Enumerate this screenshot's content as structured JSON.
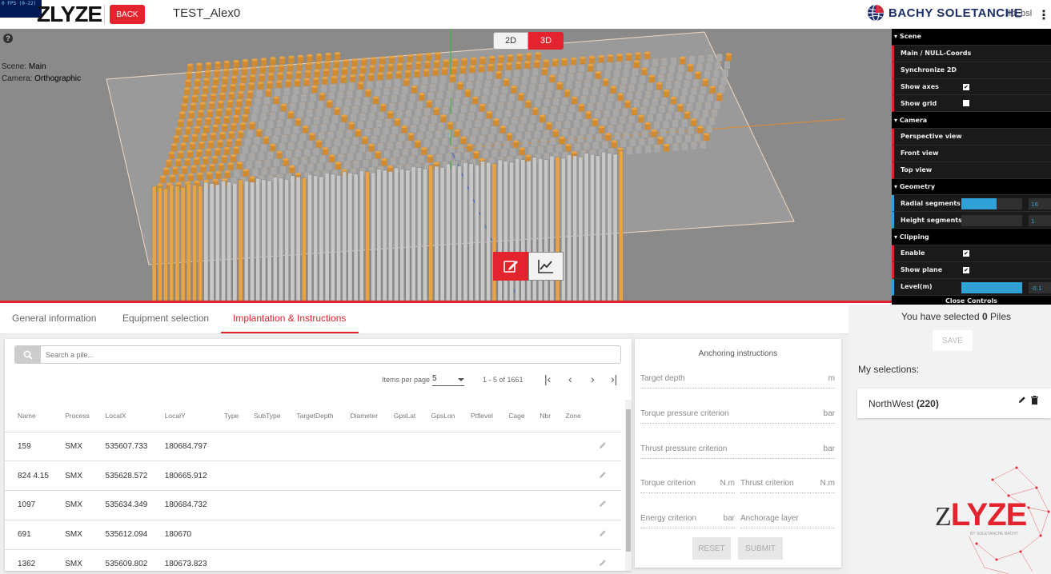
{
  "topbar": {
    "fps_text": "0 FPS (0-22)",
    "logo": "ZLYZE",
    "back_label": "BACK",
    "project_name": "TEST_Alex0",
    "brand_name": "BACHY SOLETANCHE",
    "user_name": "lld_bsl",
    "menu_glyph": "⋮"
  },
  "viewport": {
    "help_glyph": "?",
    "scene_label": "Scene:",
    "scene_value": "Main",
    "camera_label": "Camera:",
    "camera_value": "Orthographic",
    "mode_2d": "2D",
    "mode_3d": "3D",
    "active_mode": "3D"
  },
  "controls": {
    "scene_folder": "Scene",
    "main_null_coords": "Main / NULL-Coords",
    "synchronize_2d": "Synchronize 2D",
    "show_axes": "Show axes",
    "show_axes_checked": true,
    "show_grid": "Show grid",
    "show_grid_checked": false,
    "camera_folder": "Camera",
    "perspective_view": "Perspective view",
    "front_view": "Front view",
    "top_view": "Top view",
    "geometry_folder": "Geometry",
    "radial_segments": "Radial segments",
    "radial_segments_value": "16",
    "radial_segments_fill": 0.58,
    "height_segments": "Height segments",
    "height_segments_value": "1",
    "height_segments_fill": 0,
    "clipping_folder": "Clipping",
    "enable": "Enable",
    "enable_checked": true,
    "show_plane": "Show plane",
    "show_plane_checked": true,
    "level": "Level(m)",
    "level_value": "-0.1",
    "level_fill": 1,
    "close_controls": "Close Controls"
  },
  "tabs": [
    {
      "label": "General information"
    },
    {
      "label": "Equipment selection"
    },
    {
      "label": "Implantation & Instructions"
    }
  ],
  "table_card": {
    "search_placeholder": "Search a pile...",
    "items_per_page_label": "Items per page",
    "items_per_page_value": "5",
    "range_text": "1 - 5 of 1661",
    "columns": [
      "Name",
      "Process",
      "LocalX",
      "LocalY",
      "Type",
      "SubType",
      "TargetDepth",
      "Diameter",
      "GpsLat",
      "GpsLon",
      "Ptflevel",
      "Cage",
      "Nbr",
      "Zone"
    ],
    "rows": [
      {
        "name": "159",
        "process": "SMX",
        "localx": "535607.733",
        "localy": "180684.797"
      },
      {
        "name": "824 4.15",
        "process": "SMX",
        "localx": "535628.572",
        "localy": "180665.912"
      },
      {
        "name": "1097",
        "process": "SMX",
        "localx": "535634.349",
        "localy": "180684.732"
      },
      {
        "name": "691",
        "process": "SMX",
        "localx": "535612.094",
        "localy": "180670"
      },
      {
        "name": "1362",
        "process": "SMX",
        "localx": "535609.802",
        "localy": "180673.823"
      }
    ]
  },
  "anchoring": {
    "title": "Anchoring instructions",
    "target_depth": "Target depth",
    "target_depth_unit": "m",
    "torque_pressure": "Torque pressure criterion",
    "torque_pressure_unit": "bar",
    "thrust_pressure": "Thrust pressure criterion",
    "thrust_pressure_unit": "bar",
    "torque_criterion": "Torque criterion",
    "torque_criterion_unit": "N.m",
    "thrust_criterion": "Thrust criterion",
    "thrust_criterion_unit": "N.m",
    "energy_criterion": "Energy criterion",
    "energy_criterion_unit": "bar",
    "anchorage_layer": "Anchorage layer",
    "reset_label": "RESET",
    "submit_label": "SUBMIT"
  },
  "right_panel": {
    "selected_prefix": "You have selected",
    "selected_count": "0",
    "selected_suffix": "Piles",
    "save_label": "SAVE",
    "my_selections_label": "My selections:",
    "selection_name": "NorthWest",
    "selection_count": "(220)",
    "bottom_logo_z": "Z",
    "bottom_logo_rest": "LYZE",
    "bottom_logo_sub": "BY SOLETANCHE BACHY"
  },
  "colors": {
    "accent_red": "#e3232d",
    "brand_blue": "#1c2f6b",
    "pile_orange": "#e8a444",
    "pile_grey": "#c8c8c8",
    "control_blue": "#2fa1d6"
  }
}
